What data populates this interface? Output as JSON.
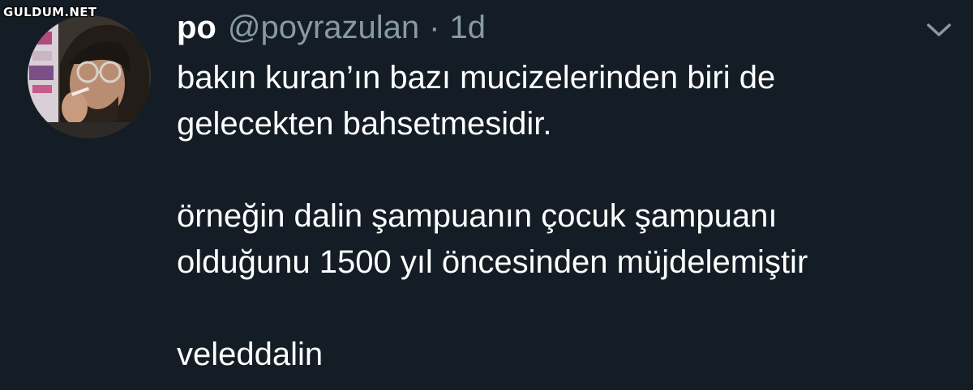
{
  "watermark": "GULDUM.NET",
  "tweet": {
    "display_name": "po",
    "handle": "@poyrazulan",
    "separator": "·",
    "timestamp": "1d",
    "lines": [
      "bakın kuran’ın bazı mucizelerinden biri de",
      "gelecekten bahsetmesidir.",
      "örneğin dalin şampuanın çocuk şampuanı",
      "olduğunu 1500 yıl öncesinden müjdelemiştir",
      "veleddalin"
    ]
  },
  "icons": {
    "caret": "chevron-down-icon",
    "avatar": "profile-photo"
  },
  "colors": {
    "background": "#141d26",
    "text_primary": "#ffffff",
    "text_secondary": "#8899a6"
  }
}
